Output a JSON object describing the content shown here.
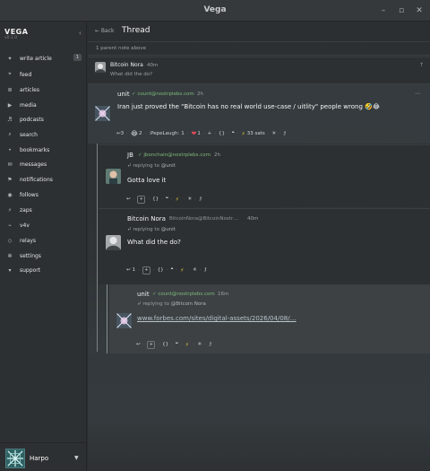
{
  "window": {
    "title": "Vega",
    "controls": {
      "minimize": "–",
      "maximize": "▫",
      "close": "✕"
    }
  },
  "sidebar": {
    "brand": "VEGA",
    "version": "v0.1.0",
    "collapse_icon": "‹",
    "items": [
      {
        "label": "write article",
        "icon": "plus",
        "badge": "1"
      },
      {
        "label": "feed",
        "icon": "feed"
      },
      {
        "label": "articles",
        "icon": "articles"
      },
      {
        "label": "media",
        "icon": "play"
      },
      {
        "label": "podcasts",
        "icon": "mic"
      },
      {
        "label": "search",
        "icon": "search"
      },
      {
        "label": "bookmarks",
        "icon": "bookmark"
      },
      {
        "label": "messages",
        "icon": "mail"
      },
      {
        "label": "notifications",
        "icon": "bell"
      },
      {
        "label": "follows",
        "icon": "users"
      },
      {
        "label": "zaps",
        "icon": "zap"
      },
      {
        "label": "v4v",
        "icon": "satellite"
      },
      {
        "label": "relays",
        "icon": "relay"
      },
      {
        "label": "settings",
        "icon": "gear"
      },
      {
        "label": "support",
        "icon": "support"
      }
    ],
    "user": {
      "name": "Harpo",
      "menu_icon": "▼"
    }
  },
  "thread": {
    "back_label": "← Back",
    "title": "Thread",
    "parent_note_label": "1 parent note above",
    "parent_note": {
      "author": "Bitcoin Nora",
      "time": "40m",
      "text": "What did the do?"
    },
    "main_note": {
      "author": "unit",
      "nip05": "✓ count@nostrplebs.com",
      "time": "2h",
      "text": "Iran just proved the \"Bitcoin has no real world use-case / uitlity\" people wrong 🤣😂",
      "actions": {
        "reply_count": "3",
        "laugh_count": "2",
        "custom_reaction": ":PepeLaugh:",
        "custom_count": "1",
        "heart_count": "1",
        "zap_label": "33 sats"
      }
    },
    "replies": [
      {
        "author": "JB",
        "nip05": "✓ jbonchain@nostrplebs.com",
        "time": "2h",
        "reply_to": "@unit",
        "text": "Gotta love it"
      },
      {
        "author": "Bitcoin Nora",
        "nip05": "BitcoinNora@BitcoinNostr....",
        "time": "40m",
        "reply_to": "@unit",
        "text": "What did the do?",
        "reply_count": "1"
      },
      {
        "author": "unit",
        "nip05": "✓ count@nostrplebs.com",
        "time": "16m",
        "reply_to": "@Bitcoin Nora",
        "text": "www.forbes.com/sites/digital-assets/2026/04/08/…"
      }
    ],
    "replying_label": "replying to",
    "icons": {
      "reply": "↩",
      "repost": "↻",
      "quote": "❝",
      "zap": "⚡",
      "sparkle": "✳",
      "share": "⮥",
      "menu": "⋯",
      "up": "↑",
      "plus": "+",
      "braces": "{}"
    }
  }
}
